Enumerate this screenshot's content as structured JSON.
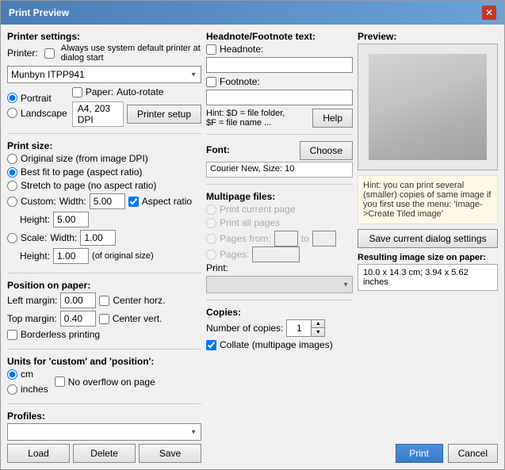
{
  "dialog": {
    "title": "Print Preview",
    "close_label": "✕"
  },
  "printer_settings": {
    "label": "Printer settings:",
    "printer_label": "Printer:",
    "always_default_label": "Always use system default printer at dialog start",
    "selected_printer": "Munbyn ITPP941",
    "portrait_label": "Portrait",
    "landscape_label": "Landscape",
    "paper_label": "Paper:",
    "auto_rotate_label": "Auto-rotate",
    "paper_value": "A4,     203 DPI",
    "printer_setup_label": "Printer setup"
  },
  "print_size": {
    "label": "Print size:",
    "original_label": "Original size (from image DPI)",
    "best_fit_label": "Best fit to page (aspect ratio)",
    "stretch_label": "Stretch to page (no aspect ratio)",
    "custom_label": "Custom:",
    "width_label": "Width:",
    "height_label": "Height:",
    "custom_width": "5.00",
    "custom_height": "5.00",
    "aspect_ratio_label": "Aspect ratio",
    "scale_label": "Scale:",
    "scale_width": "1.00",
    "scale_height": "1.00",
    "of_original_label": "(of original size)"
  },
  "position": {
    "label": "Position on paper:",
    "left_margin_label": "Left margin:",
    "top_margin_label": "Top margin:",
    "left_margin_value": "0.00",
    "top_margin_value": "0.40",
    "center_horz_label": "Center horz.",
    "center_vert_label": "Center vert.",
    "borderless_label": "Borderless printing"
  },
  "units": {
    "label": "Units for 'custom' and 'position':",
    "cm_label": "cm",
    "inches_label": "inches",
    "no_overflow_label": "No overflow on page"
  },
  "profiles": {
    "label": "Profiles:",
    "load_label": "Load",
    "delete_label": "Delete",
    "save_label": "Save"
  },
  "headnote": {
    "label": "Headnote/Footnote text:",
    "headnote_label": "Headnote:",
    "footnote_label": "Footnote:",
    "hint_label": "Hint: $D = file folder,",
    "hint_label2": "$F = file name ...",
    "help_label": "Help"
  },
  "font": {
    "label": "Font:",
    "choose_label": "Choose",
    "font_value": "Courier New, Size: 10"
  },
  "multipage": {
    "label": "Multipage files:",
    "print_current_label": "Print current page",
    "print_all_label": "Print all pages",
    "pages_from_label": "Pages from:",
    "pages_to_label": "to",
    "pages_from_value": "",
    "pages_to_value": "",
    "pages_label": "Pages:",
    "pages_value": "",
    "print_label": "Print:"
  },
  "copies": {
    "label": "Copies:",
    "number_label": "Number of copies:",
    "number_value": "1",
    "collate_label": "Collate (multipage images)"
  },
  "preview": {
    "label": "Preview:"
  },
  "hint": {
    "text": "Hint: you can print several (smaller) copies of same image if you first use the menu: 'Image->Create Tiled image'"
  },
  "save_settings": {
    "label": "Save current dialog settings"
  },
  "result_size": {
    "label": "Resulting image size on paper:",
    "value": "10.0 x 14.3 cm; 3.94 x 5.62 inches"
  },
  "buttons": {
    "print_label": "Print",
    "cancel_label": "Cancel"
  }
}
